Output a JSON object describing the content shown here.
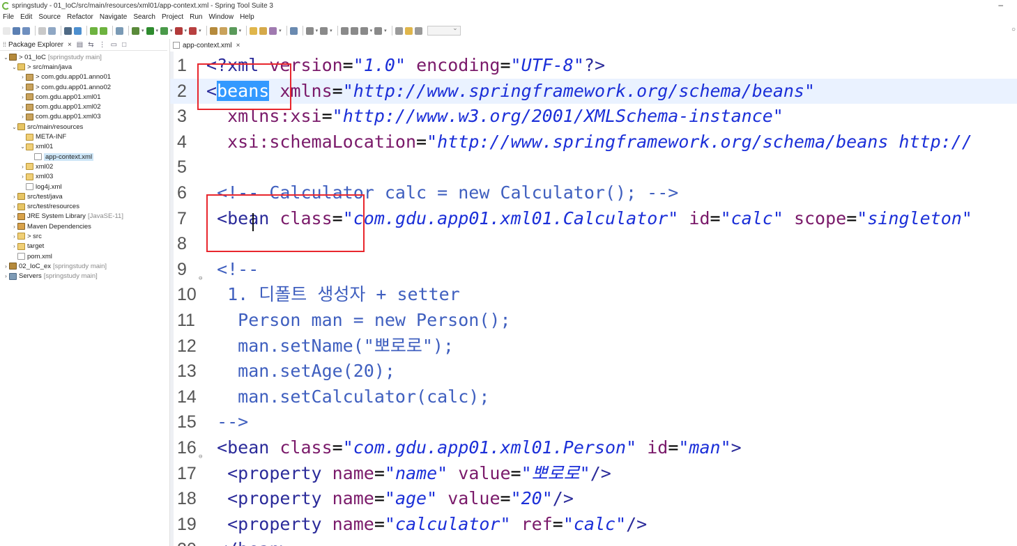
{
  "window": {
    "title": "springstudy - 01_IoC/src/main/resources/xml01/app-context.xml - Spring Tool Suite 3",
    "minimize_glyph": "–"
  },
  "menubar": {
    "items": [
      "File",
      "Edit",
      "Source",
      "Refactor",
      "Navigate",
      "Search",
      "Project",
      "Run",
      "Window",
      "Help"
    ]
  },
  "explorer": {
    "tab_label": "Package Explorer",
    "tree": [
      {
        "label": "> 01_IoC",
        "decoration": "[springstudy main]",
        "icon": "project-icon",
        "twisty": "v",
        "depth": 0
      },
      {
        "label": "> src/main/java",
        "decoration": "",
        "icon": "source-folder-icon",
        "twisty": "v",
        "depth": 1
      },
      {
        "label": "> com.gdu.app01.anno01",
        "decoration": "",
        "icon": "package-icon",
        "twisty": ">",
        "depth": 2
      },
      {
        "label": "> com.gdu.app01.anno02",
        "decoration": "",
        "icon": "package-icon",
        "twisty": ">",
        "depth": 2
      },
      {
        "label": "com.gdu.app01.xml01",
        "decoration": "",
        "icon": "package-icon",
        "twisty": ">",
        "depth": 2
      },
      {
        "label": "com.gdu.app01.xml02",
        "decoration": "",
        "icon": "package-icon",
        "twisty": ">",
        "depth": 2
      },
      {
        "label": "com.gdu.app01.xml03",
        "decoration": "",
        "icon": "package-icon",
        "twisty": ">",
        "depth": 2
      },
      {
        "label": "src/main/resources",
        "decoration": "",
        "icon": "source-folder-icon",
        "twisty": "v",
        "depth": 1
      },
      {
        "label": "META-INF",
        "decoration": "",
        "icon": "folder-icon",
        "twisty": "",
        "depth": 2
      },
      {
        "label": "xml01",
        "decoration": "",
        "icon": "folder-icon",
        "twisty": "v",
        "depth": 2
      },
      {
        "label": "app-context.xml",
        "decoration": "",
        "icon": "xml-file-icon",
        "twisty": "",
        "depth": 3,
        "selected": true
      },
      {
        "label": "xml02",
        "decoration": "",
        "icon": "folder-icon",
        "twisty": ">",
        "depth": 2
      },
      {
        "label": "xml03",
        "decoration": "",
        "icon": "folder-icon",
        "twisty": ">",
        "depth": 2
      },
      {
        "label": "log4j.xml",
        "decoration": "",
        "icon": "xml-file-icon",
        "twisty": "",
        "depth": 2
      },
      {
        "label": "src/test/java",
        "decoration": "",
        "icon": "source-folder-icon",
        "twisty": ">",
        "depth": 1
      },
      {
        "label": "src/test/resources",
        "decoration": "",
        "icon": "source-folder-icon",
        "twisty": ">",
        "depth": 1
      },
      {
        "label": "JRE System Library",
        "decoration": "[JavaSE-11]",
        "icon": "library-icon",
        "twisty": ">",
        "depth": 1
      },
      {
        "label": "Maven Dependencies",
        "decoration": "",
        "icon": "library-icon",
        "twisty": ">",
        "depth": 1
      },
      {
        "label": "> src",
        "decoration": "",
        "icon": "folder-icon",
        "twisty": ">",
        "depth": 1
      },
      {
        "label": "target",
        "decoration": "",
        "icon": "folder-icon",
        "twisty": ">",
        "depth": 1
      },
      {
        "label": "pom.xml",
        "decoration": "",
        "icon": "xml-file-icon",
        "twisty": "",
        "depth": 1
      },
      {
        "label": "02_IoC_ex",
        "decoration": "[springstudy main]",
        "icon": "project-icon",
        "twisty": ">",
        "depth": 0
      },
      {
        "label": "Servers",
        "decoration": "[springstudy main]",
        "icon": "server-folder-icon",
        "twisty": ">",
        "depth": 0
      }
    ]
  },
  "editor": {
    "tab_label": "app-context.xml",
    "lines": [
      {
        "n": "1",
        "fold": "",
        "current": false,
        "tokens": [
          [
            "pi",
            "<?xml "
          ],
          [
            "attr",
            "version"
          ],
          [
            "eq",
            "="
          ],
          [
            "str",
            "\"1.0\""
          ],
          [
            "eq",
            " "
          ],
          [
            "attr",
            "encoding"
          ],
          [
            "eq",
            "="
          ],
          [
            "str",
            "\"UTF-8\""
          ],
          [
            "pi",
            "?>"
          ]
        ]
      },
      {
        "n": "2",
        "fold": "",
        "current": true,
        "tokens": [
          [
            "tag",
            "<"
          ],
          [
            "hl",
            "beans"
          ],
          [
            "eq",
            " "
          ],
          [
            "attr",
            "xmlns"
          ],
          [
            "eq",
            "="
          ],
          [
            "str",
            "\"http://www.springframework.org/schema/beans\""
          ]
        ]
      },
      {
        "n": "3",
        "fold": "",
        "current": false,
        "tokens": [
          [
            "eq",
            "  "
          ],
          [
            "attr",
            "xmlns:xsi"
          ],
          [
            "eq",
            "="
          ],
          [
            "str",
            "\"http://www.w3.org/2001/XMLSchema-instance\""
          ]
        ]
      },
      {
        "n": "4",
        "fold": "",
        "current": false,
        "tokens": [
          [
            "eq",
            "  "
          ],
          [
            "attr",
            "xsi:schemaLocation"
          ],
          [
            "eq",
            "="
          ],
          [
            "str",
            "\"http://www.springframework.org/schema/beans http://"
          ]
        ]
      },
      {
        "n": "5",
        "fold": "",
        "current": false,
        "tokens": []
      },
      {
        "n": "6",
        "fold": "",
        "current": false,
        "tokens": [
          [
            "eq",
            " "
          ],
          [
            "com",
            "<!-- Calculator calc = new Calculator(); -->"
          ]
        ]
      },
      {
        "n": "7",
        "fold": "",
        "current": false,
        "tokens": [
          [
            "eq",
            " "
          ],
          [
            "tag",
            "<bean "
          ],
          [
            "attr",
            "class"
          ],
          [
            "eq",
            "="
          ],
          [
            "str",
            "\"com.gdu.app01.xml01.Calculator\""
          ],
          [
            "eq",
            " "
          ],
          [
            "attr",
            "id"
          ],
          [
            "eq",
            "="
          ],
          [
            "str",
            "\"calc\""
          ],
          [
            "eq",
            " "
          ],
          [
            "attr",
            "scope"
          ],
          [
            "eq",
            "="
          ],
          [
            "str",
            "\"singleton\""
          ]
        ]
      },
      {
        "n": "8",
        "fold": "",
        "current": false,
        "tokens": []
      },
      {
        "n": "9",
        "fold": "⊖",
        "current": false,
        "tokens": [
          [
            "eq",
            " "
          ],
          [
            "com",
            "<!--"
          ]
        ]
      },
      {
        "n": "10",
        "fold": "",
        "current": false,
        "tokens": [
          [
            "eq",
            "  "
          ],
          [
            "com",
            "1. 디폴트 생성자 + setter"
          ]
        ]
      },
      {
        "n": "11",
        "fold": "",
        "current": false,
        "tokens": [
          [
            "eq",
            "   "
          ],
          [
            "com",
            "Person man = new Person();"
          ]
        ]
      },
      {
        "n": "12",
        "fold": "",
        "current": false,
        "tokens": [
          [
            "eq",
            "   "
          ],
          [
            "com",
            "man.setName(\"뽀로로\");"
          ]
        ]
      },
      {
        "n": "13",
        "fold": "",
        "current": false,
        "tokens": [
          [
            "eq",
            "   "
          ],
          [
            "com",
            "man.setAge(20);"
          ]
        ]
      },
      {
        "n": "14",
        "fold": "",
        "current": false,
        "tokens": [
          [
            "eq",
            "   "
          ],
          [
            "com",
            "man.setCalculator(calc);"
          ]
        ]
      },
      {
        "n": "15",
        "fold": "",
        "current": false,
        "tokens": [
          [
            "eq",
            " "
          ],
          [
            "com",
            "-->"
          ]
        ]
      },
      {
        "n": "16",
        "fold": "⊖",
        "current": false,
        "tokens": [
          [
            "eq",
            " "
          ],
          [
            "tag",
            "<bean "
          ],
          [
            "attr",
            "class"
          ],
          [
            "eq",
            "="
          ],
          [
            "str",
            "\"com.gdu.app01.xml01.Person\""
          ],
          [
            "eq",
            " "
          ],
          [
            "attr",
            "id"
          ],
          [
            "eq",
            "="
          ],
          [
            "str",
            "\"man\""
          ],
          [
            "tag",
            ">"
          ]
        ]
      },
      {
        "n": "17",
        "fold": "",
        "current": false,
        "tokens": [
          [
            "eq",
            "  "
          ],
          [
            "tag",
            "<property "
          ],
          [
            "attr",
            "name"
          ],
          [
            "eq",
            "="
          ],
          [
            "str",
            "\"name\""
          ],
          [
            "eq",
            " "
          ],
          [
            "attr",
            "value"
          ],
          [
            "eq",
            "="
          ],
          [
            "str",
            "\"뽀로로\""
          ],
          [
            "tag",
            "/>"
          ]
        ]
      },
      {
        "n": "18",
        "fold": "",
        "current": false,
        "tokens": [
          [
            "eq",
            "  "
          ],
          [
            "tag",
            "<property "
          ],
          [
            "attr",
            "name"
          ],
          [
            "eq",
            "="
          ],
          [
            "str",
            "\"age\""
          ],
          [
            "eq",
            " "
          ],
          [
            "attr",
            "value"
          ],
          [
            "eq",
            "="
          ],
          [
            "str",
            "\"20\""
          ],
          [
            "tag",
            "/>"
          ]
        ]
      },
      {
        "n": "19",
        "fold": "",
        "current": false,
        "tokens": [
          [
            "eq",
            "  "
          ],
          [
            "tag",
            "<property "
          ],
          [
            "attr",
            "name"
          ],
          [
            "eq",
            "="
          ],
          [
            "str",
            "\"calculator\""
          ],
          [
            "eq",
            " "
          ],
          [
            "attr",
            "ref"
          ],
          [
            "eq",
            "="
          ],
          [
            "str",
            "\"calc\""
          ],
          [
            "tag",
            "/>"
          ]
        ]
      },
      {
        "n": "20",
        "fold": "",
        "current": false,
        "tokens": [
          [
            "eq",
            " "
          ],
          [
            "tag",
            "</bean>"
          ]
        ]
      }
    ]
  },
  "colors": {
    "annotation_box": "#e8262d",
    "selection": "#3399ff",
    "current_line": "#eaf2ff",
    "attribute": "#7a1a6a",
    "string": "#1b2fd8",
    "comment": "#3f5fbf"
  }
}
